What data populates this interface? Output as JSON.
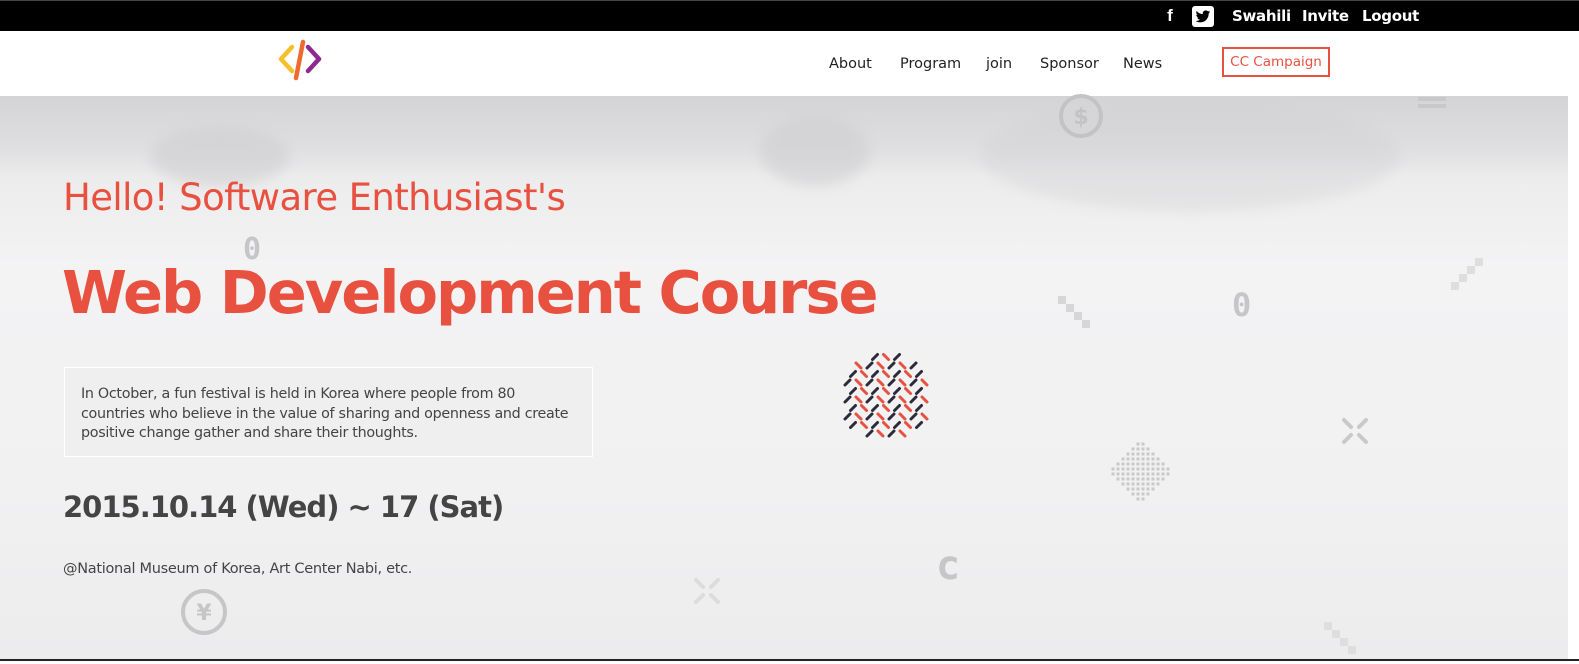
{
  "topbar": {
    "social": [
      {
        "icon": "facebook-icon",
        "glyph": "f"
      },
      {
        "icon": "twitter-icon"
      }
    ],
    "links": [
      "Swahili",
      "Invite",
      "Logout"
    ]
  },
  "nav": {
    "logo": "code-brackets-logo",
    "items": [
      "About",
      "Program",
      "join",
      "Sponsor",
      "News"
    ],
    "cta": "CC Campaign"
  },
  "hero": {
    "subtitle": "Hello! Software Enthusiast's",
    "title": "Web Development Course",
    "description": "In October, a fun festival is held in Korea where people from 80 countries who believe in the value of sharing and openness and create positive change gather and share their thoughts.",
    "date": "2015.10.14 (Wed) ~ 17 (Sat)",
    "venue": "@National Museum of Korea, Art Center Nabi, etc."
  },
  "colors": {
    "accent": "#e8503f",
    "topbar": "#000000",
    "text": "#444444",
    "logo_yellow": "#f5c02a",
    "logo_orange": "#ee6a2f",
    "logo_purple": "#8e2a8e",
    "pattern_dark": "#2b2b3a"
  }
}
